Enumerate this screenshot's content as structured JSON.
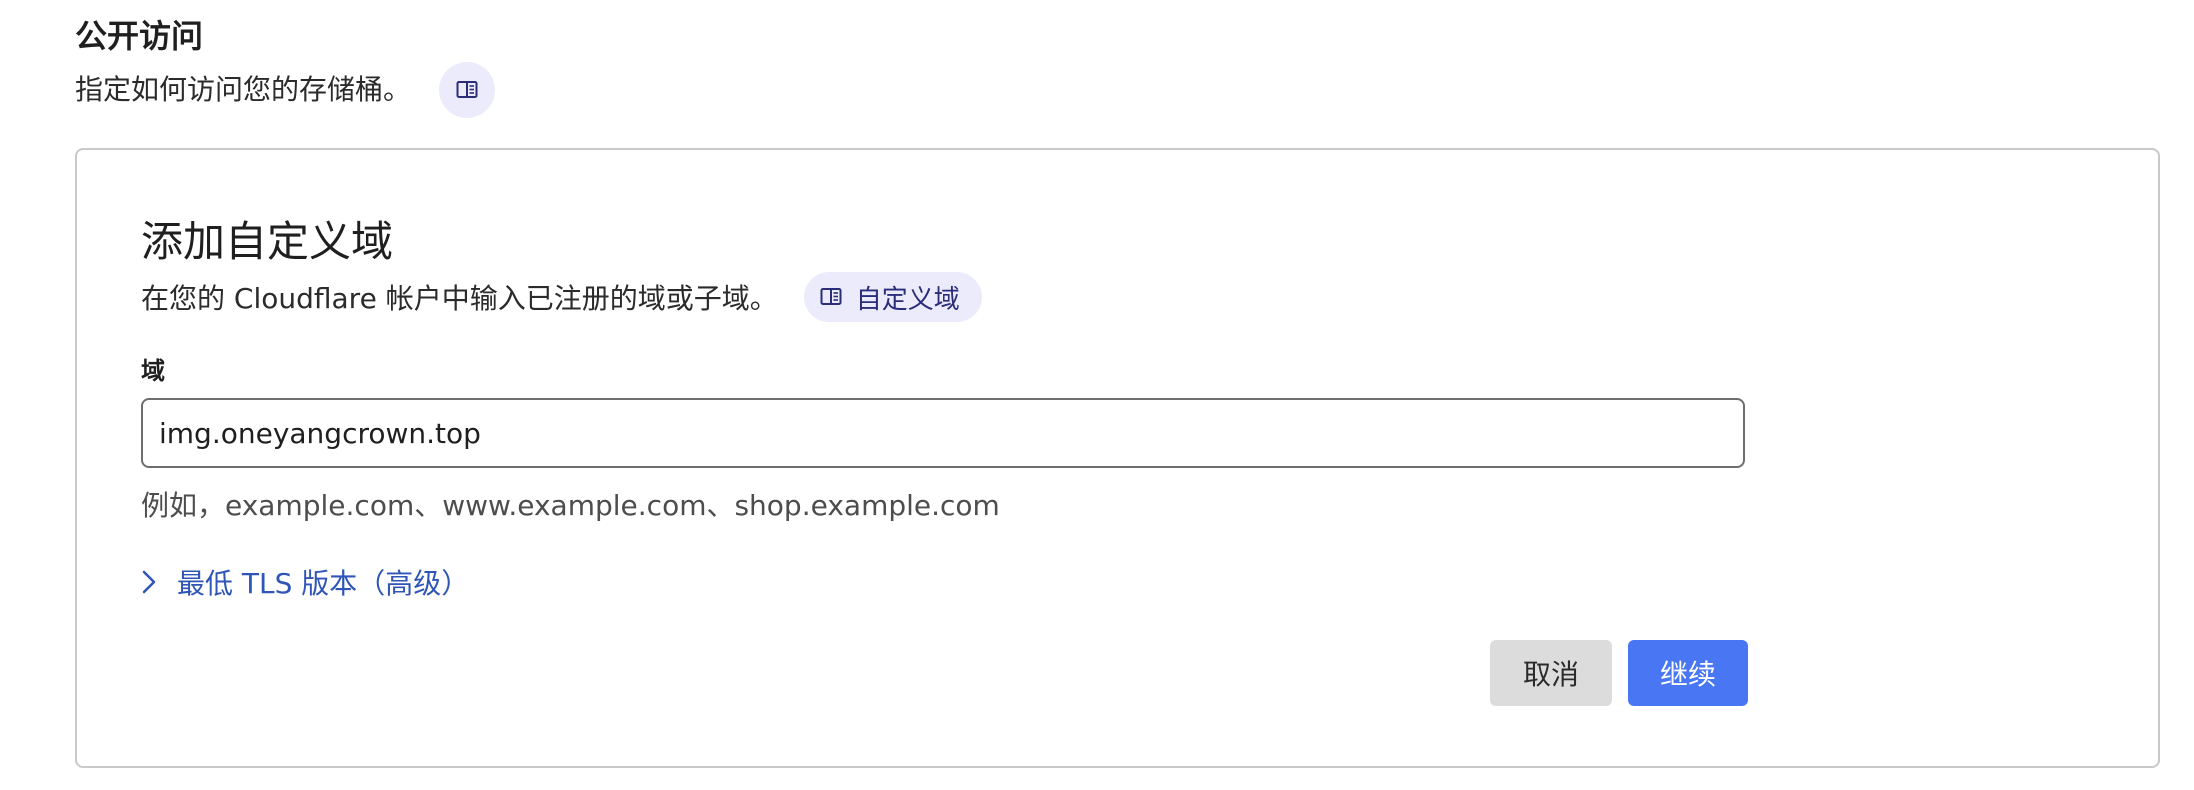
{
  "section": {
    "title": "公开访问",
    "description": "指定如何访问您的存储桶。",
    "doc_icon": "book-icon"
  },
  "card": {
    "title": "添加自定义域",
    "description": "在您的 Cloudflare 帐户中输入已注册的域或子域。",
    "doc_link_label": "自定义域",
    "doc_link_icon": "book-icon",
    "field_label": "域",
    "domain_value": "img.oneyangcrown.top",
    "helper_text": "例如，example.com、www.example.com、shop.example.com",
    "advanced_label": "最低 TLS 版本（高级）",
    "advanced_icon": "chevron-right-icon",
    "cancel_label": "取消",
    "continue_label": "继续"
  },
  "colors": {
    "accent": "#4976f2",
    "link": "#2f55b7",
    "pill_bg": "#ecebfb",
    "pill_text": "#2a2d7a"
  }
}
